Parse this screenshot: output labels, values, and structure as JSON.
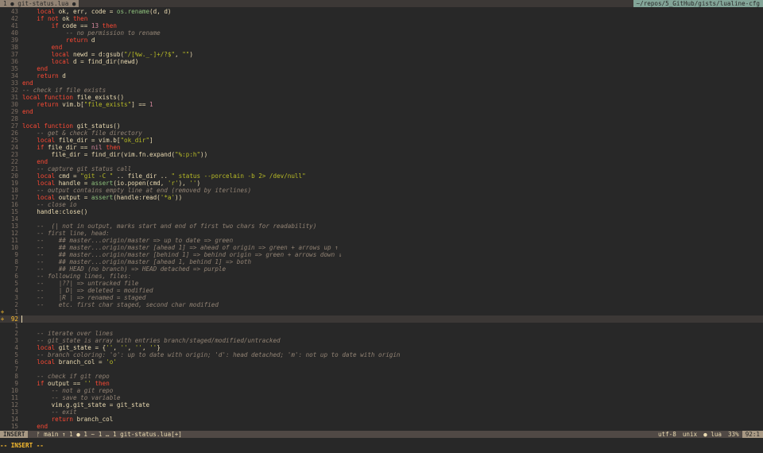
{
  "tabline": {
    "tab_label": "1 ● git-status.lua ●",
    "path": "~/repos/5_GitHub/gists/lualine-cfg"
  },
  "editor": {
    "lines": [
      {
        "sign": "",
        "num": "43",
        "tokens": [
          [
            "    ",
            ""
          ],
          [
            "local",
            "k"
          ],
          [
            " ok, err, code = ",
            ""
          ],
          [
            "os.rename",
            "f"
          ],
          [
            "(d, d)",
            ""
          ]
        ]
      },
      {
        "sign": "",
        "num": "42",
        "tokens": [
          [
            "    ",
            ""
          ],
          [
            "if not",
            "k"
          ],
          [
            " ok ",
            ""
          ],
          [
            "then",
            "k"
          ]
        ]
      },
      {
        "sign": "",
        "num": "41",
        "tokens": [
          [
            "        ",
            ""
          ],
          [
            "if",
            "k"
          ],
          [
            " code == ",
            ""
          ],
          [
            "13",
            "n"
          ],
          [
            " ",
            ""
          ],
          [
            "then",
            "k"
          ]
        ]
      },
      {
        "sign": "",
        "num": "40",
        "tokens": [
          [
            "            ",
            ""
          ],
          [
            "-- no permission to rename",
            "c"
          ]
        ]
      },
      {
        "sign": "",
        "num": "39",
        "tokens": [
          [
            "            ",
            ""
          ],
          [
            "return",
            "k"
          ],
          [
            " d",
            ""
          ]
        ]
      },
      {
        "sign": "",
        "num": "38",
        "tokens": [
          [
            "        ",
            ""
          ],
          [
            "end",
            "k"
          ]
        ]
      },
      {
        "sign": "",
        "num": "37",
        "tokens": [
          [
            "        ",
            ""
          ],
          [
            "local",
            "k"
          ],
          [
            " newd = d:gsub(",
            ""
          ],
          [
            "\"/[%w._-]+/?$\"",
            "s"
          ],
          [
            ", ",
            ""
          ],
          [
            "\"\"",
            "s"
          ],
          [
            ")",
            ""
          ]
        ]
      },
      {
        "sign": "",
        "num": "36",
        "tokens": [
          [
            "        ",
            ""
          ],
          [
            "local",
            "k"
          ],
          [
            " d = find_dir(newd)",
            ""
          ]
        ]
      },
      {
        "sign": "",
        "num": "35",
        "tokens": [
          [
            "    ",
            ""
          ],
          [
            "end",
            "k"
          ]
        ]
      },
      {
        "sign": "",
        "num": "34",
        "tokens": [
          [
            "    ",
            ""
          ],
          [
            "return",
            "k"
          ],
          [
            " d",
            ""
          ]
        ]
      },
      {
        "sign": "",
        "num": "33",
        "tokens": [
          [
            "end",
            "k"
          ]
        ]
      },
      {
        "sign": "",
        "num": "32",
        "tokens": [
          [
            "-- check if file exists",
            "c"
          ]
        ]
      },
      {
        "sign": "",
        "num": "31",
        "tokens": [
          [
            "local function",
            "k"
          ],
          [
            " file_exists()",
            ""
          ]
        ]
      },
      {
        "sign": "",
        "num": "30",
        "tokens": [
          [
            "    ",
            ""
          ],
          [
            "return",
            "k"
          ],
          [
            " vim.b[",
            ""
          ],
          [
            "\"file_exists\"",
            "s"
          ],
          [
            "] == ",
            ""
          ],
          [
            "1",
            "n"
          ]
        ]
      },
      {
        "sign": "",
        "num": "29",
        "tokens": [
          [
            "end",
            "k"
          ]
        ]
      },
      {
        "sign": "",
        "num": "28",
        "tokens": []
      },
      {
        "sign": "",
        "num": "27",
        "tokens": [
          [
            "local function",
            "k"
          ],
          [
            " git_status()",
            ""
          ]
        ]
      },
      {
        "sign": "",
        "num": "26",
        "tokens": [
          [
            "    ",
            ""
          ],
          [
            "-- get & check file directory",
            "c"
          ]
        ]
      },
      {
        "sign": "",
        "num": "25",
        "tokens": [
          [
            "    ",
            ""
          ],
          [
            "local",
            "k"
          ],
          [
            " file_dir = vim.b[",
            ""
          ],
          [
            "\"ok_dir\"",
            "s"
          ],
          [
            "]",
            ""
          ]
        ]
      },
      {
        "sign": "",
        "num": "24",
        "tokens": [
          [
            "    ",
            ""
          ],
          [
            "if",
            "k"
          ],
          [
            " file_dir == ",
            ""
          ],
          [
            "nil",
            "n"
          ],
          [
            " ",
            ""
          ],
          [
            "then",
            "k"
          ]
        ]
      },
      {
        "sign": "",
        "num": "23",
        "tokens": [
          [
            "        file_dir = find_dir(vim.fn.expand(",
            ""
          ],
          [
            "\"%:p:h\"",
            "s"
          ],
          [
            "))",
            ""
          ]
        ]
      },
      {
        "sign": "",
        "num": "22",
        "tokens": [
          [
            "    ",
            ""
          ],
          [
            "end",
            "k"
          ]
        ]
      },
      {
        "sign": "",
        "num": "21",
        "tokens": [
          [
            "    ",
            ""
          ],
          [
            "-- capture git status call",
            "c"
          ]
        ]
      },
      {
        "sign": "",
        "num": "20",
        "tokens": [
          [
            "    ",
            ""
          ],
          [
            "local",
            "k"
          ],
          [
            " cmd = ",
            ""
          ],
          [
            "\"git -C \"",
            "s"
          ],
          [
            " .. file_dir .. ",
            ""
          ],
          [
            "\" status --porcelain -b 2> /dev/null\"",
            "s"
          ]
        ]
      },
      {
        "sign": "",
        "num": "19",
        "tokens": [
          [
            "    ",
            ""
          ],
          [
            "local",
            "k"
          ],
          [
            " handle = ",
            ""
          ],
          [
            "assert",
            "f"
          ],
          [
            "(io.popen(cmd, ",
            ""
          ],
          [
            "'r'",
            "s"
          ],
          [
            "), ",
            ""
          ],
          [
            "''",
            "s"
          ],
          [
            ")",
            ""
          ]
        ]
      },
      {
        "sign": "",
        "num": "18",
        "tokens": [
          [
            "    ",
            ""
          ],
          [
            "-- output contains empty line at end (removed by iterlines)",
            "c"
          ]
        ]
      },
      {
        "sign": "",
        "num": "17",
        "tokens": [
          [
            "    ",
            ""
          ],
          [
            "local",
            "k"
          ],
          [
            " output = ",
            ""
          ],
          [
            "assert",
            "f"
          ],
          [
            "(handle:read(",
            ""
          ],
          [
            "'*a'",
            "s"
          ],
          [
            "))",
            ""
          ]
        ]
      },
      {
        "sign": "",
        "num": "16",
        "tokens": [
          [
            "    ",
            ""
          ],
          [
            "-- close io",
            "c"
          ]
        ]
      },
      {
        "sign": "",
        "num": "15",
        "tokens": [
          [
            "    handle:close()",
            ""
          ]
        ]
      },
      {
        "sign": "",
        "num": "14",
        "tokens": []
      },
      {
        "sign": "",
        "num": "13",
        "tokens": [
          [
            "    ",
            ""
          ],
          [
            "--  (| not in output, marks start and end of first two chars for readability)",
            "c"
          ]
        ]
      },
      {
        "sign": "",
        "num": "12",
        "tokens": [
          [
            "    ",
            ""
          ],
          [
            "-- first line, head:",
            "c"
          ]
        ]
      },
      {
        "sign": "",
        "num": "11",
        "tokens": [
          [
            "    ",
            ""
          ],
          [
            "--    ## master...origin/master => up to date => green",
            "c"
          ]
        ]
      },
      {
        "sign": "",
        "num": "10",
        "tokens": [
          [
            "    ",
            ""
          ],
          [
            "--    ## master...origin/master [ahead 1] => ahead of origin => green + arrows up ↑",
            "c"
          ]
        ]
      },
      {
        "sign": "",
        "num": "9",
        "tokens": [
          [
            "    ",
            ""
          ],
          [
            "--    ## master...origin/master [behind 1] => behind origin => green + arrows down ↓",
            "c"
          ]
        ]
      },
      {
        "sign": "",
        "num": "8",
        "tokens": [
          [
            "    ",
            ""
          ],
          [
            "--    ## master...origin/master [ahead 1, behind 1] => both",
            "c"
          ]
        ]
      },
      {
        "sign": "",
        "num": "7",
        "tokens": [
          [
            "    ",
            ""
          ],
          [
            "--    ## HEAD (no branch) => HEAD detached => purple",
            "c"
          ]
        ]
      },
      {
        "sign": "",
        "num": "6",
        "tokens": [
          [
            "    ",
            ""
          ],
          [
            "-- following lines, files:",
            "c"
          ]
        ]
      },
      {
        "sign": "",
        "num": "5",
        "tokens": [
          [
            "    ",
            ""
          ],
          [
            "--    |??| => untracked file",
            "c"
          ]
        ]
      },
      {
        "sign": "",
        "num": "4",
        "tokens": [
          [
            "    ",
            ""
          ],
          [
            "--    | D| => deleted = modified",
            "c"
          ]
        ]
      },
      {
        "sign": "",
        "num": "3",
        "tokens": [
          [
            "    ",
            ""
          ],
          [
            "--    |R | => renamed = staged",
            "c"
          ]
        ]
      },
      {
        "sign": "",
        "num": "2",
        "tokens": [
          [
            "    ",
            ""
          ],
          [
            "--    etc. first char staged, second char modified",
            "c"
          ]
        ]
      },
      {
        "sign": "+",
        "num": "1",
        "tokens": []
      },
      {
        "sign": "+",
        "num": "92",
        "current": true,
        "tokens": []
      },
      {
        "sign": "",
        "num": "1",
        "tokens": []
      },
      {
        "sign": "",
        "num": "2",
        "tokens": [
          [
            "    ",
            ""
          ],
          [
            "-- iterate over lines",
            "c"
          ]
        ]
      },
      {
        "sign": "",
        "num": "3",
        "tokens": [
          [
            "    ",
            ""
          ],
          [
            "-- git_state is array with entries branch/staged/modified/untracked",
            "c"
          ]
        ]
      },
      {
        "sign": "",
        "num": "4",
        "tokens": [
          [
            "    ",
            ""
          ],
          [
            "local",
            "k"
          ],
          [
            " git_state = {",
            ""
          ],
          [
            "''",
            "s"
          ],
          [
            ", ",
            ""
          ],
          [
            "''",
            "s"
          ],
          [
            ", ",
            ""
          ],
          [
            "''",
            "s"
          ],
          [
            ", ",
            ""
          ],
          [
            "''",
            "s"
          ],
          [
            "}",
            ""
          ]
        ]
      },
      {
        "sign": "",
        "num": "5",
        "tokens": [
          [
            "    ",
            ""
          ],
          [
            "-- branch coloring: 'o': up to date with origin; 'd': head detached; 'm': not up to date with origin",
            "c"
          ]
        ]
      },
      {
        "sign": "",
        "num": "6",
        "tokens": [
          [
            "    ",
            ""
          ],
          [
            "local",
            "k"
          ],
          [
            " branch_col = ",
            ""
          ],
          [
            "'o'",
            "s"
          ]
        ]
      },
      {
        "sign": "",
        "num": "7",
        "tokens": []
      },
      {
        "sign": "",
        "num": "8",
        "tokens": [
          [
            "    ",
            ""
          ],
          [
            "-- check if git repo",
            "c"
          ]
        ]
      },
      {
        "sign": "",
        "num": "9",
        "tokens": [
          [
            "    ",
            ""
          ],
          [
            "if",
            "k"
          ],
          [
            " output == ",
            ""
          ],
          [
            "''",
            "s"
          ],
          [
            " ",
            ""
          ],
          [
            "then",
            "k"
          ]
        ]
      },
      {
        "sign": "",
        "num": "10",
        "tokens": [
          [
            "        ",
            ""
          ],
          [
            "-- not a git repo",
            "c"
          ]
        ]
      },
      {
        "sign": "",
        "num": "11",
        "tokens": [
          [
            "        ",
            ""
          ],
          [
            "-- save to variable",
            "c"
          ]
        ]
      },
      {
        "sign": "",
        "num": "12",
        "tokens": [
          [
            "        vim.g.git_state = git_state",
            ""
          ]
        ]
      },
      {
        "sign": "",
        "num": "13",
        "tokens": [
          [
            "        ",
            ""
          ],
          [
            "-- exit",
            "c"
          ]
        ]
      },
      {
        "sign": "",
        "num": "14",
        "tokens": [
          [
            "        ",
            ""
          ],
          [
            "return",
            "k"
          ],
          [
            " branch_col",
            ""
          ]
        ]
      },
      {
        "sign": "",
        "num": "15",
        "tokens": [
          [
            "    ",
            ""
          ],
          [
            "end",
            "k"
          ]
        ]
      }
    ]
  },
  "statusline": {
    "mode": "INSERT",
    "branch": "ᚠ main ↑ 1  ● 1  ~ 1  … 1   git-status.lua[+]",
    "encoding": "utf-8",
    "format": "unix",
    "filetype": "● lua",
    "percent": "33%",
    "position": "92:1"
  },
  "cmdline": {
    "text": "-- INSERT --"
  }
}
